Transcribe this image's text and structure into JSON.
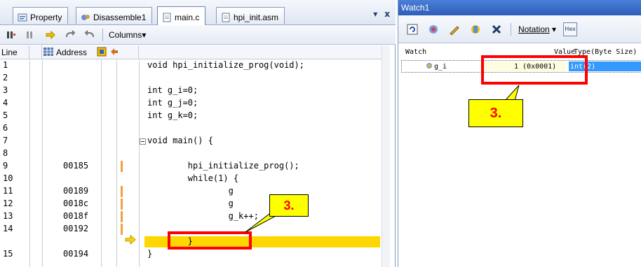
{
  "editor": {
    "tabs": [
      {
        "label": "Property",
        "icon": "property-icon"
      },
      {
        "label": "Disassemble1",
        "icon": "disassemble-icon"
      },
      {
        "label": "main.c",
        "icon": "file-icon"
      },
      {
        "label": "hpi_init.asm",
        "icon": "file-icon"
      }
    ],
    "tab_controls": {
      "dropdown": "▾",
      "close": "x"
    },
    "toolbar": {
      "columns_label": "Columns"
    },
    "columns": {
      "line": "Line",
      "address": "Address"
    },
    "lines": [
      {
        "num": "1",
        "addr": "",
        "src": "void hpi_initialize_prog(void);"
      },
      {
        "num": "2",
        "addr": "",
        "src": ""
      },
      {
        "num": "3",
        "addr": "",
        "src": "int g_i=0;"
      },
      {
        "num": "4",
        "addr": "",
        "src": "int g_j=0;"
      },
      {
        "num": "5",
        "addr": "",
        "src": "int g_k=0;"
      },
      {
        "num": "6",
        "addr": "",
        "src": ""
      },
      {
        "num": "7",
        "addr": "",
        "src": "void main() {"
      },
      {
        "num": "8",
        "addr": "",
        "src": ""
      },
      {
        "num": "9",
        "addr": "00185",
        "src": "        hpi_initialize_prog();"
      },
      {
        "num": "10",
        "addr": "",
        "src": "        while(1) {"
      },
      {
        "num": "11",
        "addr": "00189",
        "src": "                g"
      },
      {
        "num": "12",
        "addr": "0018c",
        "src": "                g"
      },
      {
        "num": "13",
        "addr": "0018f",
        "src": "                g_k++;"
      },
      {
        "num": "14",
        "addr": "00192",
        "src": "        }"
      },
      {
        "num": "15",
        "addr": "00194",
        "src": "}"
      }
    ],
    "callout": "3."
  },
  "watch": {
    "title": "Watch1",
    "toolbar": {
      "notation_label": "Notation",
      "hex_label": "Hex"
    },
    "headers": {
      "watch": "Watch",
      "value": "Value",
      "type": "Type(Byte Size)"
    },
    "row": {
      "name": "g_i",
      "value": "1 (0x0001)",
      "type": "int(2)"
    },
    "callout": "3."
  },
  "colors": {
    "highlight": "#ffd700",
    "callout_bg": "#ffff00",
    "callout_text": "#ff0000",
    "title_bar": "#2e5fb8"
  }
}
